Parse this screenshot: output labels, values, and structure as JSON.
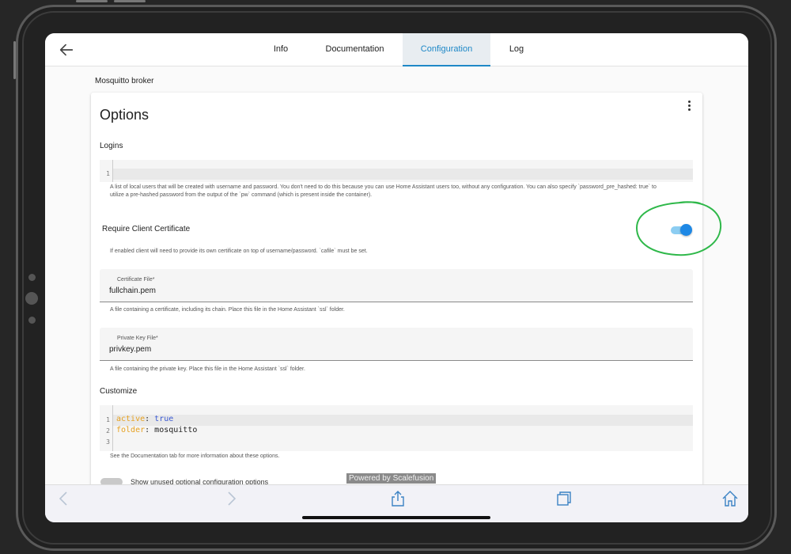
{
  "nav": {
    "back_icon": "arrow-left-icon",
    "tabs": [
      {
        "label": "Info",
        "active": false
      },
      {
        "label": "Documentation",
        "active": false
      },
      {
        "label": "Configuration",
        "active": true
      },
      {
        "label": "Log",
        "active": false
      }
    ]
  },
  "addon_name": "Mosquitto broker",
  "options": {
    "title": "Options",
    "menu_icon": "kebab-menu-icon",
    "logins": {
      "label": "Logins",
      "editor_lines": [
        "1"
      ],
      "helper": "A list of local users that will be created with username and password. You don't need to do this because you can use Home Assistant users too, without any configuration. You can also specify `password_pre_hashed: true` to utilize a pre-hashed password from the output of the `pw` command (which is present inside the container)."
    },
    "require_client_certificate": {
      "label": "Require Client Certificate",
      "enabled": true,
      "helper": "If enabled client will need to provide its own certificate on top of username/password. `cafile` must be set."
    },
    "certificate_file": {
      "label": "Certificate File*",
      "value": "fullchain.pem",
      "helper": "A file containing a certificate, including its chain. Place this file in the Home Assistant `ssl` folder."
    },
    "private_key_file": {
      "label": "Private Key File*",
      "value": "privkey.pem",
      "helper": "A file containing the private key. Place this file in the Home Assistant `ssl` folder."
    },
    "customize": {
      "label": "Customize",
      "line_numbers": [
        "1",
        "2",
        "3"
      ],
      "line1_key": "active",
      "line1_colon": ": ",
      "line1_value": "true",
      "line2_key": "folder",
      "line2_colon": ": ",
      "line2_value": "mosquitto",
      "helper": "See the Documentation tab for more information about these options."
    },
    "show_unused_label": "Show unused optional configuration options"
  },
  "overlay": {
    "powered_by": "Powered by Scalefusion"
  },
  "browser_toolbar": {
    "icons": [
      "chevron-left-icon",
      "chevron-right-icon",
      "share-icon",
      "tabs-icon",
      "home-icon"
    ]
  },
  "colors": {
    "accent": "#1e88c7",
    "toggle_on": "#1e88e5",
    "annotation": "#2fb84a"
  }
}
